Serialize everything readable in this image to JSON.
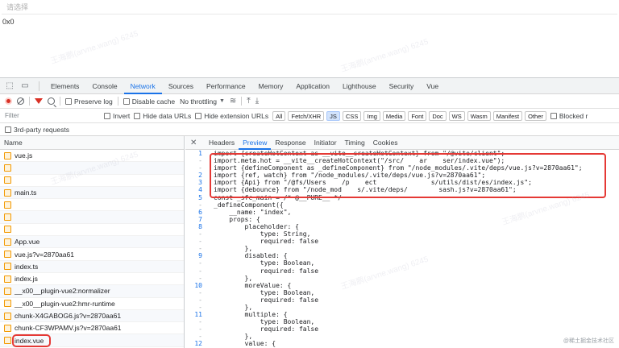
{
  "page": {
    "select_placeholder": "请选择",
    "size_text": "0x0"
  },
  "devtools": {
    "tabs": [
      "Elements",
      "Console",
      "Network",
      "Sources",
      "Performance",
      "Memory",
      "Application",
      "Lighthouse",
      "Security",
      "Vue"
    ],
    "active_tab": "Network",
    "toolbar": {
      "preserve_log": "Preserve log",
      "disable_cache": "Disable cache",
      "throttle": "No throttling"
    },
    "filterbar": {
      "filter_placeholder": "Filter",
      "invert": "Invert",
      "hide_data_urls": "Hide data URLs",
      "hide_extension_urls": "Hide extension URLs",
      "chips": [
        "All",
        "Fetch/XHR",
        "JS",
        "CSS",
        "Img",
        "Media",
        "Font",
        "Doc",
        "WS",
        "Wasm",
        "Manifest",
        "Other"
      ],
      "active_chip": "JS",
      "blocked": "Blocked r"
    },
    "third_party": "3rd-party requests",
    "requests": {
      "header": "Name",
      "rows": [
        "vue.js",
        "",
        "",
        "main.ts",
        "",
        "",
        "",
        "App.vue",
        "vue.js?v=2870aa61",
        "index.ts",
        "index.js",
        "__x00__plugin-vue2:normalizer",
        "__x00__plugin-vue2:hmr-runtime",
        "chunk-X4GABOG6.js?v=2870aa61",
        "chunk-CF3WPAMV.js?v=2870aa61",
        "index.vue",
        "index.js"
      ],
      "selected_index": 15
    },
    "detail": {
      "tabs": [
        "Headers",
        "Preview",
        "Response",
        "Initiator",
        "Timing",
        "Cookies"
      ],
      "active_tab": "Preview",
      "code_lines": [
        {
          "n": "1",
          "t": "import {createHotContext as __vite__createHotContext} from \"/@vite/client\";"
        },
        {
          "n": "-",
          "t": "import.meta.hot = __vite__createHotContext(\"/src/    ar    ser/index.vue\");"
        },
        {
          "n": "-",
          "t": "import {defineComponent as _defineComponent} from \"/node_modules/.vite/deps/vue.js?v=2870aa61\";"
        },
        {
          "n": "2",
          "t": "import {ref, watch} from \"/node_modules/.vite/deps/vue.js?v=2870aa61\";"
        },
        {
          "n": "3",
          "t": "import {Api} from \"/@fs/Users    /p    ect              s/utils/dist/es/index.js\";"
        },
        {
          "n": "4",
          "t": "import {debounce} from \"/node_mod    s/.vite/deps/        sash.js?v=2870aa61\";"
        },
        {
          "n": "5",
          "t": "const _sfc_main = /* @__PURE__ */"
        },
        {
          "n": "-",
          "t": "_defineComponent({"
        },
        {
          "n": "6",
          "t": "    __name: \"index\","
        },
        {
          "n": "7",
          "t": "    props: {"
        },
        {
          "n": "8",
          "t": "        placeholder: {"
        },
        {
          "n": "-",
          "t": "            type: String,"
        },
        {
          "n": "-",
          "t": "            required: false"
        },
        {
          "n": "-",
          "t": "        },"
        },
        {
          "n": "9",
          "t": "        disabled: {"
        },
        {
          "n": "-",
          "t": "            type: Boolean,"
        },
        {
          "n": "-",
          "t": "            required: false"
        },
        {
          "n": "-",
          "t": "        },"
        },
        {
          "n": "10",
          "t": "        moreValue: {"
        },
        {
          "n": "-",
          "t": "            type: Boolean,"
        },
        {
          "n": "-",
          "t": "            required: false"
        },
        {
          "n": "-",
          "t": "        },"
        },
        {
          "n": "11",
          "t": "        multiple: {"
        },
        {
          "n": "-",
          "t": "            type: Boolean,"
        },
        {
          "n": "-",
          "t": "            required: false"
        },
        {
          "n": "-",
          "t": "        },"
        },
        {
          "n": "12",
          "t": "        value: {"
        }
      ]
    }
  },
  "footer_mark": "@稀土掘金技术社区",
  "watermark": "王海鹏(arvne.wang) 6245"
}
